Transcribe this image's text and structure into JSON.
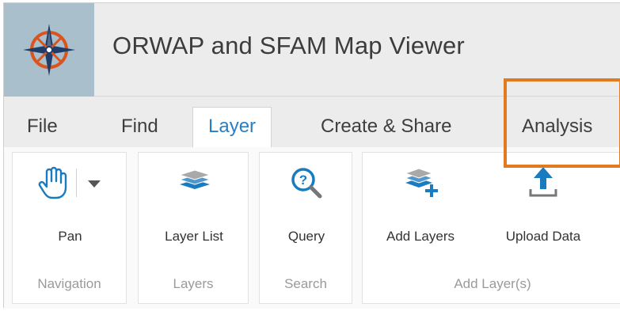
{
  "app": {
    "title": "ORWAP and SFAM Map Viewer",
    "logo_icon": "compass-rose-icon"
  },
  "tabs": [
    {
      "label": "File"
    },
    {
      "label": "Find"
    },
    {
      "label": "Layer",
      "active": true
    },
    {
      "label": "Create & Share"
    },
    {
      "label": "Analysis"
    }
  ],
  "ribbon": {
    "groups": [
      {
        "label": "Navigation",
        "tools": [
          {
            "label": "Pan",
            "icon": "hand-icon",
            "dropdown_icon": "caret-down-icon"
          }
        ]
      },
      {
        "label": "Layers",
        "tools": [
          {
            "label": "Layer List",
            "icon": "layers-icon"
          }
        ]
      },
      {
        "label": "Search",
        "tools": [
          {
            "label": "Query",
            "icon": "magnifier-question-icon"
          }
        ]
      },
      {
        "label": "Add Layer(s)",
        "tools": [
          {
            "label": "Add Layers",
            "icon": "add-layers-icon"
          },
          {
            "label": "Upload Data",
            "icon": "upload-icon"
          }
        ]
      }
    ]
  },
  "colors": {
    "active_tab_text": "#2a7fc4",
    "highlight_border": "#e07b1f",
    "icon_blue": "#1a7cc0",
    "logo_orange": "#d9541e",
    "logo_navy": "#1f3d6b"
  }
}
